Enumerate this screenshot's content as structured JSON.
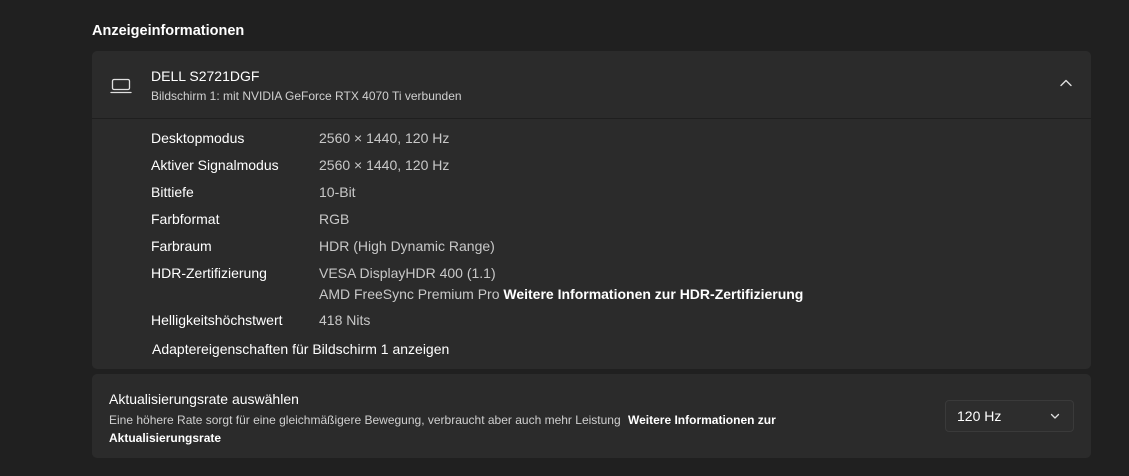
{
  "section_title": "Anzeigeinformationen",
  "display": {
    "name": "DELL S2721DGF",
    "subtitle": "Bildschirm 1: mit NVIDIA GeForce RTX 4070 Ti verbunden",
    "icon": "monitor-icon",
    "expand_icon": "chevron-up-icon",
    "rows": [
      {
        "label": "Desktopmodus",
        "value": "2560 × 1440, 120 Hz"
      },
      {
        "label": "Aktiver Signalmodus",
        "value": "2560 × 1440, 120 Hz"
      },
      {
        "label": "Bittiefe",
        "value": "10-Bit"
      },
      {
        "label": "Farbformat",
        "value": "RGB"
      },
      {
        "label": "Farbraum",
        "value": "HDR (High Dynamic Range)"
      },
      {
        "label": "HDR-Zertifizierung",
        "value": "VESA DisplayHDR 400 (1.1)",
        "value2": "AMD FreeSync Premium Pro",
        "link": "Weitere Informationen zur HDR-Zertifizierung"
      },
      {
        "label": "Helligkeitshöchstwert",
        "value": "418 Nits"
      }
    ],
    "adapter_link": "Adaptereigenschaften für Bildschirm 1 anzeigen"
  },
  "refresh": {
    "title": "Aktualisierungsrate auswählen",
    "description": "Eine höhere Rate sorgt für eine gleichmäßigere Bewegung, verbraucht aber auch mehr Leistung",
    "more_link": "Weitere Informationen zur Aktualisierungsrate",
    "selected": "120 Hz",
    "dropdown_icon": "chevron-down-icon"
  }
}
